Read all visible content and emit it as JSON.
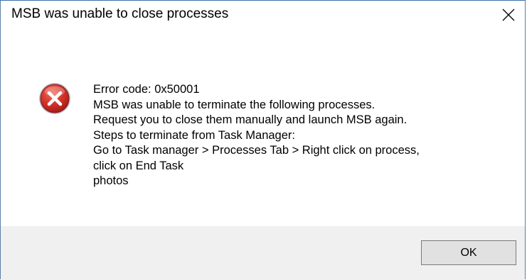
{
  "dialog": {
    "title": "MSB was unable to close processes",
    "close_glyph": "✕",
    "icon": "error-icon",
    "message_lines": [
      "Error code: 0x50001",
      "MSB was unable to terminate the following processes.",
      "Request you to close them manually and launch MSB again.",
      "Steps to terminate from Task Manager:",
      "Go to Task manager > Processes Tab > Right click on process,",
      "click on End Task",
      "photos"
    ],
    "ok_label": "OK"
  },
  "colors": {
    "footer_bg": "#f0f0f0",
    "button_bg": "#e1e1e1",
    "button_border": "#7a7a7a",
    "error_red": "#c42b1c",
    "window_border": "#3a6ea5"
  }
}
